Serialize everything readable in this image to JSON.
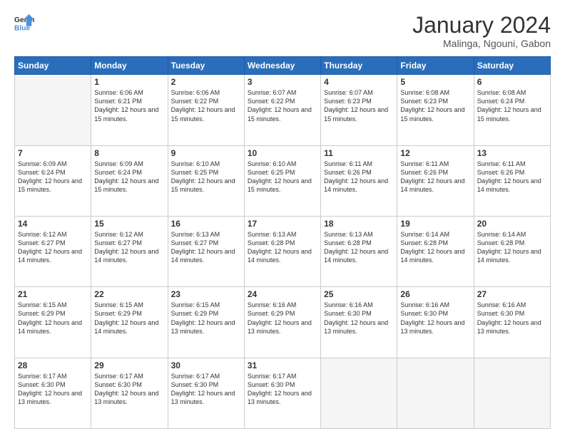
{
  "header": {
    "logo_line1": "General",
    "logo_line2": "Blue",
    "title": "January 2024",
    "subtitle": "Malinga, Ngouni, Gabon"
  },
  "weekdays": [
    "Sunday",
    "Monday",
    "Tuesday",
    "Wednesday",
    "Thursday",
    "Friday",
    "Saturday"
  ],
  "weeks": [
    [
      {
        "day": "",
        "empty": true
      },
      {
        "day": "1",
        "sunrise": "6:06 AM",
        "sunset": "6:21 PM",
        "daylight": "12 hours and 15 minutes."
      },
      {
        "day": "2",
        "sunrise": "6:06 AM",
        "sunset": "6:22 PM",
        "daylight": "12 hours and 15 minutes."
      },
      {
        "day": "3",
        "sunrise": "6:07 AM",
        "sunset": "6:22 PM",
        "daylight": "12 hours and 15 minutes."
      },
      {
        "day": "4",
        "sunrise": "6:07 AM",
        "sunset": "6:23 PM",
        "daylight": "12 hours and 15 minutes."
      },
      {
        "day": "5",
        "sunrise": "6:08 AM",
        "sunset": "6:23 PM",
        "daylight": "12 hours and 15 minutes."
      },
      {
        "day": "6",
        "sunrise": "6:08 AM",
        "sunset": "6:24 PM",
        "daylight": "12 hours and 15 minutes."
      }
    ],
    [
      {
        "day": "7",
        "sunrise": "6:09 AM",
        "sunset": "6:24 PM",
        "daylight": "12 hours and 15 minutes."
      },
      {
        "day": "8",
        "sunrise": "6:09 AM",
        "sunset": "6:24 PM",
        "daylight": "12 hours and 15 minutes."
      },
      {
        "day": "9",
        "sunrise": "6:10 AM",
        "sunset": "6:25 PM",
        "daylight": "12 hours and 15 minutes."
      },
      {
        "day": "10",
        "sunrise": "6:10 AM",
        "sunset": "6:25 PM",
        "daylight": "12 hours and 15 minutes."
      },
      {
        "day": "11",
        "sunrise": "6:11 AM",
        "sunset": "6:26 PM",
        "daylight": "12 hours and 14 minutes."
      },
      {
        "day": "12",
        "sunrise": "6:11 AM",
        "sunset": "6:26 PM",
        "daylight": "12 hours and 14 minutes."
      },
      {
        "day": "13",
        "sunrise": "6:11 AM",
        "sunset": "6:26 PM",
        "daylight": "12 hours and 14 minutes."
      }
    ],
    [
      {
        "day": "14",
        "sunrise": "6:12 AM",
        "sunset": "6:27 PM",
        "daylight": "12 hours and 14 minutes."
      },
      {
        "day": "15",
        "sunrise": "6:12 AM",
        "sunset": "6:27 PM",
        "daylight": "12 hours and 14 minutes."
      },
      {
        "day": "16",
        "sunrise": "6:13 AM",
        "sunset": "6:27 PM",
        "daylight": "12 hours and 14 minutes."
      },
      {
        "day": "17",
        "sunrise": "6:13 AM",
        "sunset": "6:28 PM",
        "daylight": "12 hours and 14 minutes."
      },
      {
        "day": "18",
        "sunrise": "6:13 AM",
        "sunset": "6:28 PM",
        "daylight": "12 hours and 14 minutes."
      },
      {
        "day": "19",
        "sunrise": "6:14 AM",
        "sunset": "6:28 PM",
        "daylight": "12 hours and 14 minutes."
      },
      {
        "day": "20",
        "sunrise": "6:14 AM",
        "sunset": "6:28 PM",
        "daylight": "12 hours and 14 minutes."
      }
    ],
    [
      {
        "day": "21",
        "sunrise": "6:15 AM",
        "sunset": "6:29 PM",
        "daylight": "12 hours and 14 minutes."
      },
      {
        "day": "22",
        "sunrise": "6:15 AM",
        "sunset": "6:29 PM",
        "daylight": "12 hours and 14 minutes."
      },
      {
        "day": "23",
        "sunrise": "6:15 AM",
        "sunset": "6:29 PM",
        "daylight": "12 hours and 13 minutes."
      },
      {
        "day": "24",
        "sunrise": "6:16 AM",
        "sunset": "6:29 PM",
        "daylight": "12 hours and 13 minutes."
      },
      {
        "day": "25",
        "sunrise": "6:16 AM",
        "sunset": "6:30 PM",
        "daylight": "12 hours and 13 minutes."
      },
      {
        "day": "26",
        "sunrise": "6:16 AM",
        "sunset": "6:30 PM",
        "daylight": "12 hours and 13 minutes."
      },
      {
        "day": "27",
        "sunrise": "6:16 AM",
        "sunset": "6:30 PM",
        "daylight": "12 hours and 13 minutes."
      }
    ],
    [
      {
        "day": "28",
        "sunrise": "6:17 AM",
        "sunset": "6:30 PM",
        "daylight": "12 hours and 13 minutes."
      },
      {
        "day": "29",
        "sunrise": "6:17 AM",
        "sunset": "6:30 PM",
        "daylight": "12 hours and 13 minutes."
      },
      {
        "day": "30",
        "sunrise": "6:17 AM",
        "sunset": "6:30 PM",
        "daylight": "12 hours and 13 minutes."
      },
      {
        "day": "31",
        "sunrise": "6:17 AM",
        "sunset": "6:30 PM",
        "daylight": "12 hours and 13 minutes."
      },
      {
        "day": "",
        "empty": true
      },
      {
        "day": "",
        "empty": true
      },
      {
        "day": "",
        "empty": true
      }
    ]
  ],
  "labels": {
    "sunrise": "Sunrise:",
    "sunset": "Sunset:",
    "daylight": "Daylight:"
  }
}
